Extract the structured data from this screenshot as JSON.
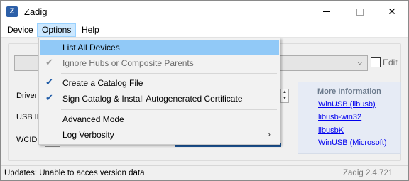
{
  "window": {
    "title": "Zadig",
    "icon_glyph": "Z",
    "controls": {
      "close_glyph": "✕"
    }
  },
  "menubar": {
    "items": [
      {
        "label": "Device"
      },
      {
        "label": "Options"
      },
      {
        "label": "Help"
      }
    ]
  },
  "options_menu": {
    "items": [
      {
        "label": "List All Devices",
        "checked": false,
        "enabled": true,
        "highlighted": true
      },
      {
        "label": "Ignore Hubs or Composite Parents",
        "checked": true,
        "enabled": false
      },
      {
        "label": "Create a Catalog File",
        "checked": true,
        "enabled": true
      },
      {
        "label": "Sign Catalog & Install Autogenerated Certificate",
        "checked": true,
        "enabled": true
      },
      {
        "label": "Advanced Mode",
        "checked": false,
        "enabled": true
      },
      {
        "label": "Log Verbosity",
        "checked": false,
        "enabled": true,
        "submenu": true
      }
    ],
    "check_glyph": "✔",
    "submenu_glyph": "›"
  },
  "main": {
    "device_combo_value": "",
    "dropdown_glyph": "⌵",
    "edit_label": "Edit",
    "driver_label": "Driver",
    "usb_id_label": "USB ID",
    "wcid_label": "WCID"
  },
  "info_panel": {
    "title": "More Information",
    "links": [
      {
        "label": "WinUSB (libusb)"
      },
      {
        "label": "libusb-win32"
      },
      {
        "label": "libusbK"
      },
      {
        "label": "WinUSB (Microsoft)"
      }
    ]
  },
  "statusbar": {
    "status": "Updates: Unable to acces version data",
    "version": "Zadig 2.4.721"
  },
  "colors": {
    "menu_highlight": "#91c9f7",
    "check": "#1e5aa6",
    "link": "#0000ee",
    "info_panel_bg": "#e6ebf5"
  }
}
